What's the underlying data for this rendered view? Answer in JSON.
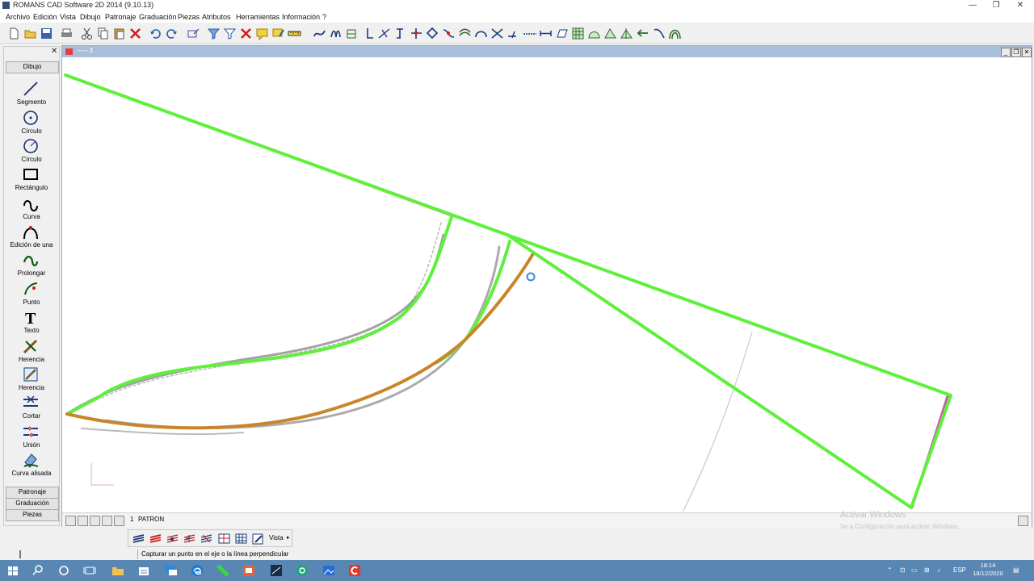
{
  "window": {
    "title": "ROMANS CAD Software 2D 2014 (9.10.13)",
    "minimize": "—",
    "maximize": "❐",
    "close": "✕"
  },
  "menu": [
    "Archivo",
    "Edición",
    "Vista",
    "Dibujo",
    "Patronaje",
    "Graduación",
    "Piezas",
    "Atributos",
    "Herramientas",
    "Información",
    "?"
  ],
  "toolbar_icons": [
    "new-file-icon",
    "open-folder-icon",
    "save-icon",
    "print-icon",
    "cut-icon",
    "copy-icon",
    "paste-icon",
    "delete-icon",
    "undo-icon",
    "redo-icon",
    "select-icon",
    "filter-icon",
    "filter-icon",
    "delete-filter-icon",
    "comment-icon",
    "comment-edit-icon",
    "measure-icon",
    "curve-icon",
    "move-icon",
    "piece-icon",
    "axis-icon",
    "perpendicular-icon",
    "axis-cross-icon",
    "distance-icon",
    "grid-move-icon",
    "node-icon",
    "hook-icon",
    "offset-icon",
    "arc-icon",
    "intersect-icon",
    "tangent-icon",
    "dashed-line-icon",
    "distance-measure-icon",
    "rectangle-icon",
    "grid-icon",
    "seam-icon",
    "notch-icon",
    "mirror-icon",
    "arrow-icon",
    "tool-icon",
    "arch-icon"
  ],
  "left_panel": {
    "header": "Dibujo",
    "tools": [
      {
        "label": "Segmento",
        "icon": "segment-icon"
      },
      {
        "label": "Círculo",
        "icon": "circle-icon"
      },
      {
        "label": "Círculo",
        "icon": "circle-radius-icon"
      },
      {
        "label": "Rectángulo",
        "icon": "rectangle-icon"
      },
      {
        "label": "Curva",
        "icon": "curve-icon"
      },
      {
        "label": "Edición de una",
        "icon": "edit-curve-icon"
      },
      {
        "label": "Prolongar",
        "icon": "extend-icon"
      },
      {
        "label": "Punto",
        "icon": "point-icon"
      },
      {
        "label": "Texto",
        "icon": "text-icon"
      },
      {
        "label": "Herencia",
        "icon": "inherit-icon"
      },
      {
        "label": "Herencia",
        "icon": "inherit-piece-icon"
      },
      {
        "label": "Cortar",
        "icon": "cut-icon"
      },
      {
        "label": "Unión",
        "icon": "join-icon"
      },
      {
        "label": "Curva alisada",
        "icon": "smooth-curve-icon"
      }
    ],
    "tabs": [
      "Patronaje",
      "Graduación",
      "Piezas"
    ]
  },
  "drawing_window": {
    "title": "----- 3",
    "layer_number": "1",
    "layer_name": "PATRON"
  },
  "bottom_toolbar": {
    "vista_label": "Vista",
    "icons": [
      "layers-icon",
      "layers-red-icon",
      "layers-edit-icon",
      "layers-add-icon",
      "layers-remove-icon",
      "frame-icon",
      "table-icon",
      "pen-icon"
    ]
  },
  "status_message": "Capturar un punto en el eje o la línea perpendicular",
  "watermark": {
    "line1": "Activar Windows",
    "line2": "Ve a Configuración para activar Windows."
  },
  "taskbar": {
    "language": "ESP",
    "time": "18:14",
    "date": "18/12/2020"
  },
  "colors": {
    "pattern_line": "#5ef03a",
    "selected_curve": "#c8862a",
    "cursor": "#3a8ad8",
    "taskbar": "#5987b3",
    "title_accent": "#a9bfd9"
  }
}
